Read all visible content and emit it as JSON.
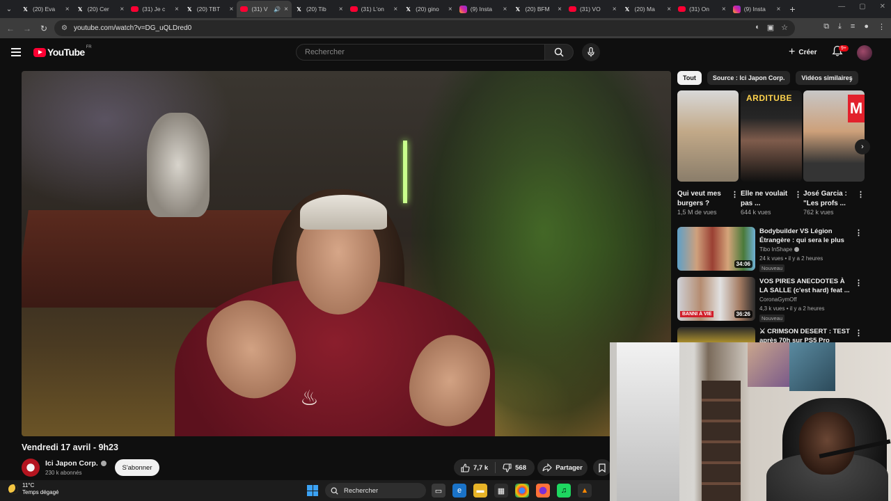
{
  "browser": {
    "tabs": [
      {
        "icon": "x-icon",
        "label": "(20) Eva"
      },
      {
        "icon": "x-icon",
        "label": "(20) Cer"
      },
      {
        "icon": "youtube-icon",
        "label": "(31) Je c"
      },
      {
        "icon": "x-icon",
        "label": "(20) TBT"
      },
      {
        "icon": "youtube-icon",
        "label": "(31) V",
        "active": true
      },
      {
        "icon": "x-icon",
        "label": "(20) Tib"
      },
      {
        "icon": "youtube-icon",
        "label": "(31) L'on"
      },
      {
        "icon": "x-icon",
        "label": "(20) gino"
      },
      {
        "icon": "instagram-icon",
        "label": "(9) Insta"
      },
      {
        "icon": "x-icon",
        "label": "(20) BFM"
      },
      {
        "icon": "youtube-icon",
        "label": "(31) VO"
      },
      {
        "icon": "x-icon",
        "label": "(20) Ma"
      },
      {
        "icon": "youtube-icon",
        "label": "(31) On"
      },
      {
        "icon": "instagram-icon",
        "label": "(9) Insta"
      }
    ],
    "url": "youtube.com/watch?v=DG_uQLDred0"
  },
  "youtube": {
    "logo_text": "YouTube",
    "region": "FR",
    "search_placeholder": "Rechercher",
    "create_label": "Créer",
    "notif_count": "9+"
  },
  "video": {
    "title": "Vendredi 17 avril - 9h23",
    "channel": "Ici Japon Corp.",
    "subscribers": "230 k abonnés",
    "subscribe_label": "S'abonner",
    "likes": "7,7 k",
    "dislikes": "568",
    "share_label": "Partager"
  },
  "sidebar": {
    "chips": [
      "Tout",
      "Source : Ici Japon Corp.",
      "Vidéos similaires"
    ],
    "shorts": [
      {
        "title": "Qui veut mes burgers ?",
        "views": "1,5 M de vues"
      },
      {
        "title": "Elle ne voulait pas ...",
        "views": "644 k vues",
        "badge": "ARDITUBE"
      },
      {
        "title": "José Garcia : \"Les profs ...",
        "views": "762 k vues",
        "badge": "M"
      }
    ],
    "videos": [
      {
        "title": "Bodybuilder VS Légion Étrangère : qui sera le plus fort...",
        "channel": "Tibo InShape",
        "meta": "24 k vues • il y a 2 heures",
        "tag": "Nouveau",
        "duration": "34:06"
      },
      {
        "title": "VOS PIRES ANECDOTES À LA SALLE (c'est hard) feat ...",
        "channel": "CoronaGymOff",
        "meta": "4,3 k vues • il y a 2 heures",
        "tag": "Nouveau",
        "duration": "36:26",
        "overlay": "BANNI À VIE"
      },
      {
        "title": "⚔ CRIMSON DESERT : TEST après 70h sur PS5 Pro (histoir...",
        "channel": "",
        "meta": "",
        "tag": "",
        "duration": ""
      }
    ]
  },
  "taskbar": {
    "temperature": "11°C",
    "weather": "Temps dégagé",
    "search_label": "Rechercher"
  }
}
